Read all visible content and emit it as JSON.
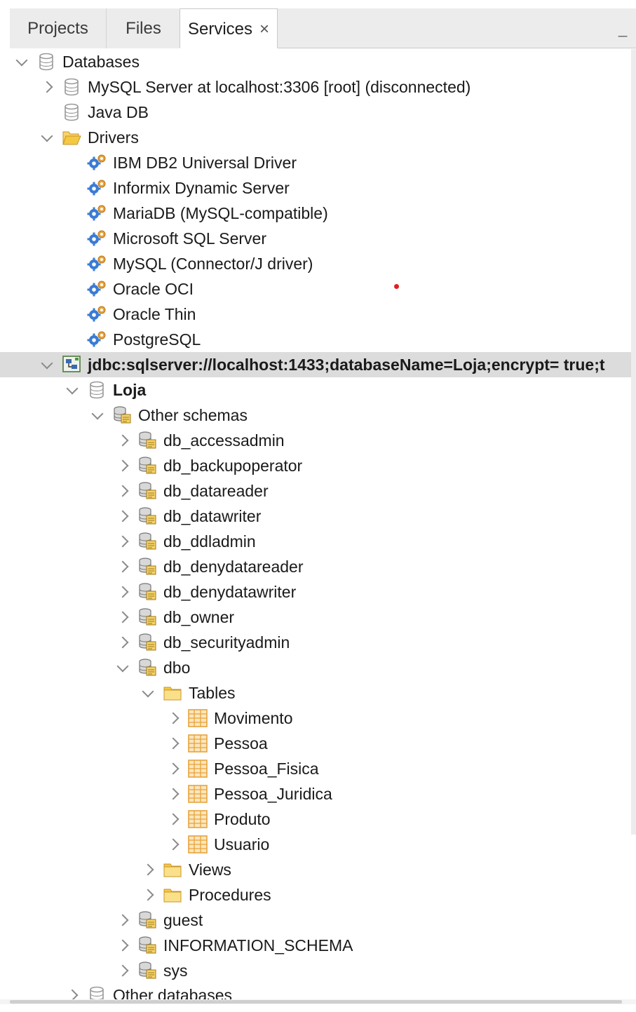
{
  "tabs": [
    {
      "label": "Projects",
      "active": false
    },
    {
      "label": "Files",
      "active": false
    },
    {
      "label": "Services",
      "active": true
    }
  ],
  "tab_close_glyph": "×",
  "minimize_glyph": "_",
  "tree": [
    {
      "label": "Databases",
      "icon": "database-icon",
      "expanded": true
    },
    {
      "label": "MySQL Server at localhost:3306 [root] (disconnected)",
      "icon": "database-icon",
      "expanded": false
    },
    {
      "label": "Java DB",
      "icon": "database-icon"
    },
    {
      "label": "Drivers",
      "icon": "open-folder-icon",
      "expanded": true
    },
    {
      "label": "IBM DB2 Universal Driver",
      "icon": "driver-gear-icon"
    },
    {
      "label": "Informix Dynamic Server",
      "icon": "driver-gear-icon"
    },
    {
      "label": "MariaDB (MySQL-compatible)",
      "icon": "driver-gear-icon"
    },
    {
      "label": "Microsoft SQL Server",
      "icon": "driver-gear-icon"
    },
    {
      "label": "MySQL (Connector/J driver)",
      "icon": "driver-gear-icon"
    },
    {
      "label": "Oracle OCI",
      "icon": "driver-gear-icon"
    },
    {
      "label": "Oracle Thin",
      "icon": "driver-gear-icon"
    },
    {
      "label": "PostgreSQL",
      "icon": "driver-gear-icon"
    },
    {
      "label": "jdbc:sqlserver://localhost:1433;databaseName=Loja;encrypt= true;t",
      "icon": "connection-icon",
      "expanded": true,
      "selected": true
    },
    {
      "label": "Loja",
      "icon": "database-icon",
      "expanded": true
    },
    {
      "label": "Other schemas",
      "icon": "schema-icon",
      "expanded": true
    },
    {
      "label": "db_accessadmin",
      "icon": "schema-icon",
      "expanded": false
    },
    {
      "label": "db_backupoperator",
      "icon": "schema-icon",
      "expanded": false
    },
    {
      "label": "db_datareader",
      "icon": "schema-icon",
      "expanded": false
    },
    {
      "label": "db_datawriter",
      "icon": "schema-icon",
      "expanded": false
    },
    {
      "label": "db_ddladmin",
      "icon": "schema-icon",
      "expanded": false
    },
    {
      "label": "db_denydatareader",
      "icon": "schema-icon",
      "expanded": false
    },
    {
      "label": "db_denydatawriter",
      "icon": "schema-icon",
      "expanded": false
    },
    {
      "label": "db_owner",
      "icon": "schema-icon",
      "expanded": false
    },
    {
      "label": "db_securityadmin",
      "icon": "schema-icon",
      "expanded": false
    },
    {
      "label": "dbo",
      "icon": "schema-icon",
      "expanded": true
    },
    {
      "label": "Tables",
      "icon": "folder-icon",
      "expanded": true
    },
    {
      "label": "Movimento",
      "icon": "table-icon",
      "expanded": false
    },
    {
      "label": "Pessoa",
      "icon": "table-icon",
      "expanded": false
    },
    {
      "label": "Pessoa_Fisica",
      "icon": "table-icon",
      "expanded": false
    },
    {
      "label": "Pessoa_Juridica",
      "icon": "table-icon",
      "expanded": false
    },
    {
      "label": "Produto",
      "icon": "table-icon",
      "expanded": false
    },
    {
      "label": "Usuario",
      "icon": "table-icon",
      "expanded": false
    },
    {
      "label": "Views",
      "icon": "folder-icon",
      "expanded": false
    },
    {
      "label": "Procedures",
      "icon": "folder-icon",
      "expanded": false
    },
    {
      "label": "guest",
      "icon": "schema-icon",
      "expanded": false
    },
    {
      "label": "INFORMATION_SCHEMA",
      "icon": "schema-icon",
      "expanded": false
    },
    {
      "label": "sys",
      "icon": "schema-icon",
      "expanded": false
    },
    {
      "label": "Other databases",
      "icon": "database-icon",
      "expanded": false
    }
  ],
  "colors": {
    "selection": "#dcdcdc",
    "folder": "#f5c842",
    "table": "#e8a33a",
    "gear": "#3a7bd5",
    "database": "#9a9a9a"
  }
}
